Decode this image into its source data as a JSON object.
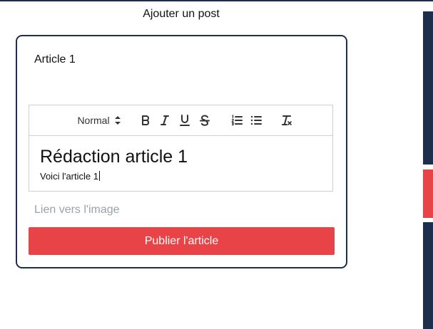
{
  "page": {
    "title": "Ajouter un post"
  },
  "form": {
    "title_value": "Article 1",
    "editor": {
      "toolbar": {
        "header_select": "Normal",
        "buttons": [
          "bold-icon",
          "italic-icon",
          "underline-icon",
          "strike-icon",
          "ordered-list-icon",
          "bullet-list-icon",
          "clean-format-icon"
        ]
      },
      "heading": "Rédaction article 1",
      "paragraph": "Voici l'article 1"
    },
    "image_link_placeholder": "Lien vers l'image",
    "image_link_value": "",
    "publish_label": "Publier l'article"
  },
  "colors": {
    "navy": "#1e2f4d",
    "accent_red": "#e84447",
    "placeholder": "#9aa1aa"
  }
}
